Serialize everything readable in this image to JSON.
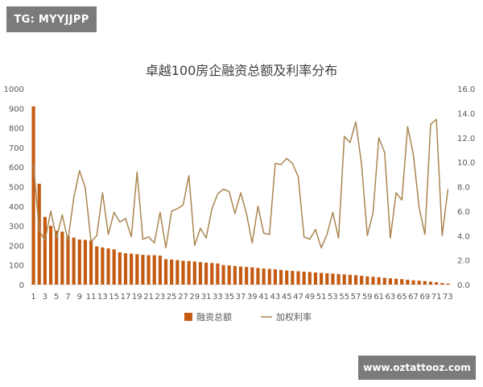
{
  "watermarks": {
    "top_left": "TG: MYYJJPP",
    "bottom_right": "www.oztattooz.com"
  },
  "chart_data": {
    "type": "bar",
    "title": "卓越100房企融资总额及利率分布",
    "xlabel": "",
    "ylabel": "",
    "ylim": [
      0,
      1000
    ],
    "y2lim": [
      0,
      16
    ],
    "yticks": [
      "0",
      "100",
      "200",
      "300",
      "400",
      "500",
      "600",
      "700",
      "800",
      "900",
      "1000"
    ],
    "y2ticks": [
      "0.0",
      "2.0",
      "4.0",
      "6.0",
      "8.0",
      "10.0",
      "12.0",
      "14.0",
      "16.0"
    ],
    "grid": false,
    "legend_position": "bottom",
    "colors": {
      "bar": "#c55a11",
      "line": "#a9864f",
      "axis": "#d9d9d9",
      "text": "#595959"
    },
    "categories": [
      1,
      2,
      3,
      4,
      5,
      6,
      7,
      8,
      9,
      10,
      11,
      12,
      13,
      14,
      15,
      16,
      17,
      18,
      19,
      20,
      21,
      22,
      23,
      24,
      25,
      26,
      27,
      28,
      29,
      30,
      31,
      32,
      33,
      34,
      35,
      36,
      37,
      38,
      39,
      40,
      41,
      42,
      43,
      44,
      45,
      46,
      47,
      48,
      49,
      50,
      51,
      52,
      53,
      54,
      55,
      56,
      57,
      58,
      59,
      60,
      61,
      62,
      63,
      64,
      65,
      66,
      67,
      68,
      69,
      70,
      71,
      72,
      73
    ],
    "xtick_labels": [
      "1",
      "3",
      "5",
      "7",
      "9",
      "11",
      "13",
      "15",
      "17",
      "19",
      "21",
      "23",
      "25",
      "27",
      "29",
      "31",
      "33",
      "35",
      "37",
      "39",
      "41",
      "43",
      "45",
      "47",
      "49",
      "51",
      "53",
      "55",
      "57",
      "59",
      "61",
      "63",
      "65",
      "67",
      "69",
      "71",
      "73"
    ],
    "series": [
      {
        "name": "融资总额",
        "type": "bar",
        "values": [
          910,
          515,
          345,
          300,
          275,
          270,
          250,
          240,
          230,
          228,
          225,
          195,
          190,
          185,
          180,
          165,
          160,
          158,
          155,
          152,
          150,
          150,
          148,
          130,
          128,
          125,
          122,
          120,
          118,
          115,
          112,
          110,
          108,
          100,
          98,
          95,
          92,
          90,
          88,
          85,
          82,
          80,
          78,
          75,
          72,
          70,
          68,
          66,
          64,
          62,
          60,
          58,
          56,
          54,
          52,
          50,
          48,
          45,
          42,
          40,
          38,
          35,
          32,
          30,
          28,
          25,
          22,
          20,
          18,
          15,
          12,
          8,
          5
        ]
      },
      {
        "name": "加权利率",
        "type": "line",
        "values": [
          9.9,
          4.4,
          3.6,
          6.0,
          3.8,
          5.7,
          3.6,
          7.1,
          9.3,
          7.9,
          3.5,
          4.0,
          7.5,
          4.1,
          5.9,
          5.1,
          5.4,
          3.9,
          9.2,
          3.7,
          3.9,
          3.4,
          5.9,
          3.0,
          6.0,
          6.2,
          6.5,
          8.9,
          3.2,
          4.6,
          3.8,
          6.2,
          7.4,
          7.8,
          7.6,
          5.8,
          7.5,
          5.8,
          3.4,
          6.4,
          4.2,
          4.1,
          9.9,
          9.8,
          10.3,
          9.9,
          8.8,
          3.9,
          3.7,
          4.5,
          3.0,
          4.1,
          5.9,
          3.8,
          12.1,
          11.6,
          13.3,
          9.8,
          4.0,
          5.9,
          12.0,
          10.8,
          3.8,
          7.5,
          6.9,
          12.9,
          10.6,
          6.3,
          4.1,
          13.1,
          13.5,
          4.0,
          7.8
        ]
      }
    ]
  }
}
